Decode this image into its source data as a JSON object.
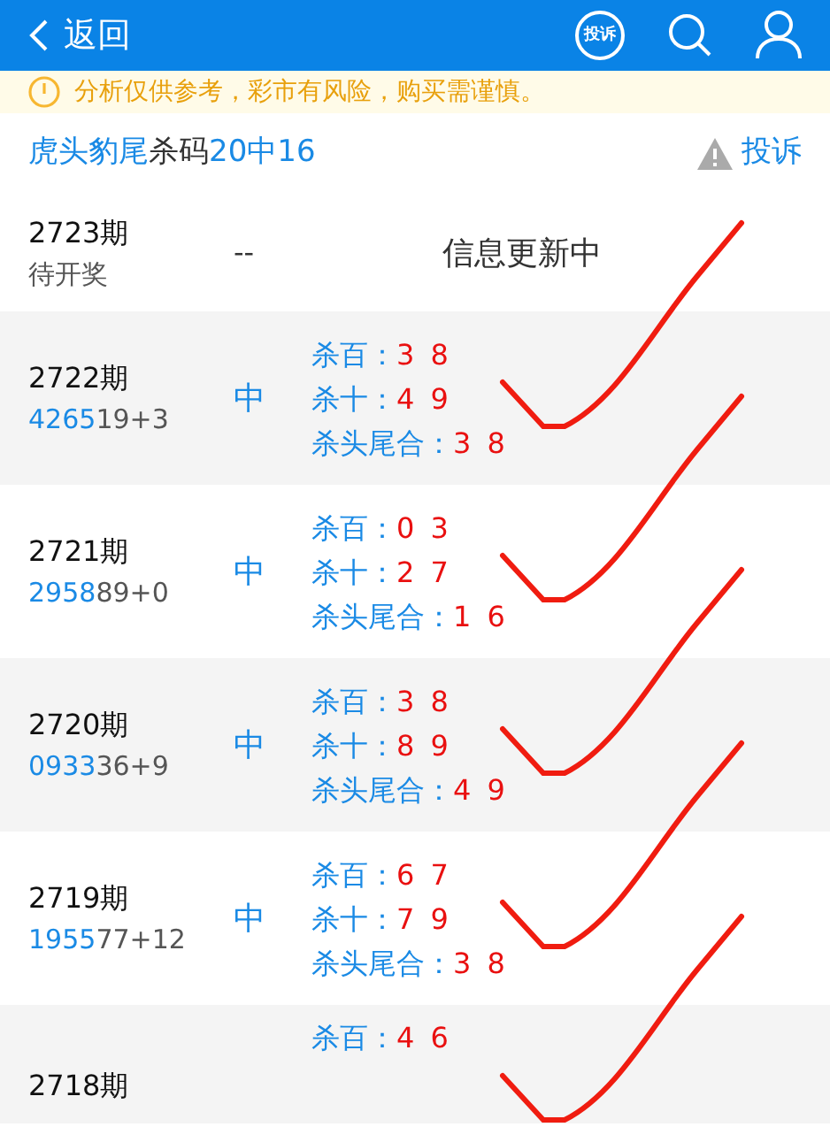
{
  "header": {
    "back_label": "返回",
    "badge_label": "投诉"
  },
  "notice": {
    "text": "分析仅供参考，彩市有风险，购买需谨慎。"
  },
  "title_bar": {
    "title_blue": "虎头豹尾",
    "title_dark": "杀码",
    "result": "20中16",
    "complaint_label": "投诉"
  },
  "pending": {
    "period": "2723期",
    "status": "待开奖",
    "dash": "--",
    "message": "信息更新中"
  },
  "rows": [
    {
      "period": "2722期",
      "draw_highlight": "4265",
      "draw_rest": "19+3",
      "verdict": "中",
      "checked": true,
      "predictions": [
        {
          "label": "杀百：",
          "value": "3 8"
        },
        {
          "label": "杀十：",
          "value": "4 9"
        },
        {
          "label": "杀头尾合：",
          "value": "3 8"
        }
      ]
    },
    {
      "period": "2721期",
      "draw_highlight": "2958",
      "draw_rest": "89+0",
      "verdict": "中",
      "checked": true,
      "predictions": [
        {
          "label": "杀百：",
          "value": "0 3"
        },
        {
          "label": "杀十：",
          "value": "2 7"
        },
        {
          "label": "杀头尾合：",
          "value": "1 6"
        }
      ]
    },
    {
      "period": "2720期",
      "draw_highlight": "0933",
      "draw_rest": "36+9",
      "verdict": "中",
      "checked": true,
      "predictions": [
        {
          "label": "杀百：",
          "value": "3 8"
        },
        {
          "label": "杀十：",
          "value": "8 9"
        },
        {
          "label": "杀头尾合：",
          "value": "4 9"
        }
      ]
    },
    {
      "period": "2719期",
      "draw_highlight": "1955",
      "draw_rest": "77+12",
      "verdict": "中",
      "checked": true,
      "predictions": [
        {
          "label": "杀百：",
          "value": "6 7"
        },
        {
          "label": "杀十：",
          "value": "7 9"
        },
        {
          "label": "杀头尾合：",
          "value": "3 8"
        }
      ]
    },
    {
      "period": "2718期",
      "verdict": "",
      "checked": true,
      "predictions": [
        {
          "label": "杀百：",
          "value": "4 6"
        }
      ]
    }
  ]
}
